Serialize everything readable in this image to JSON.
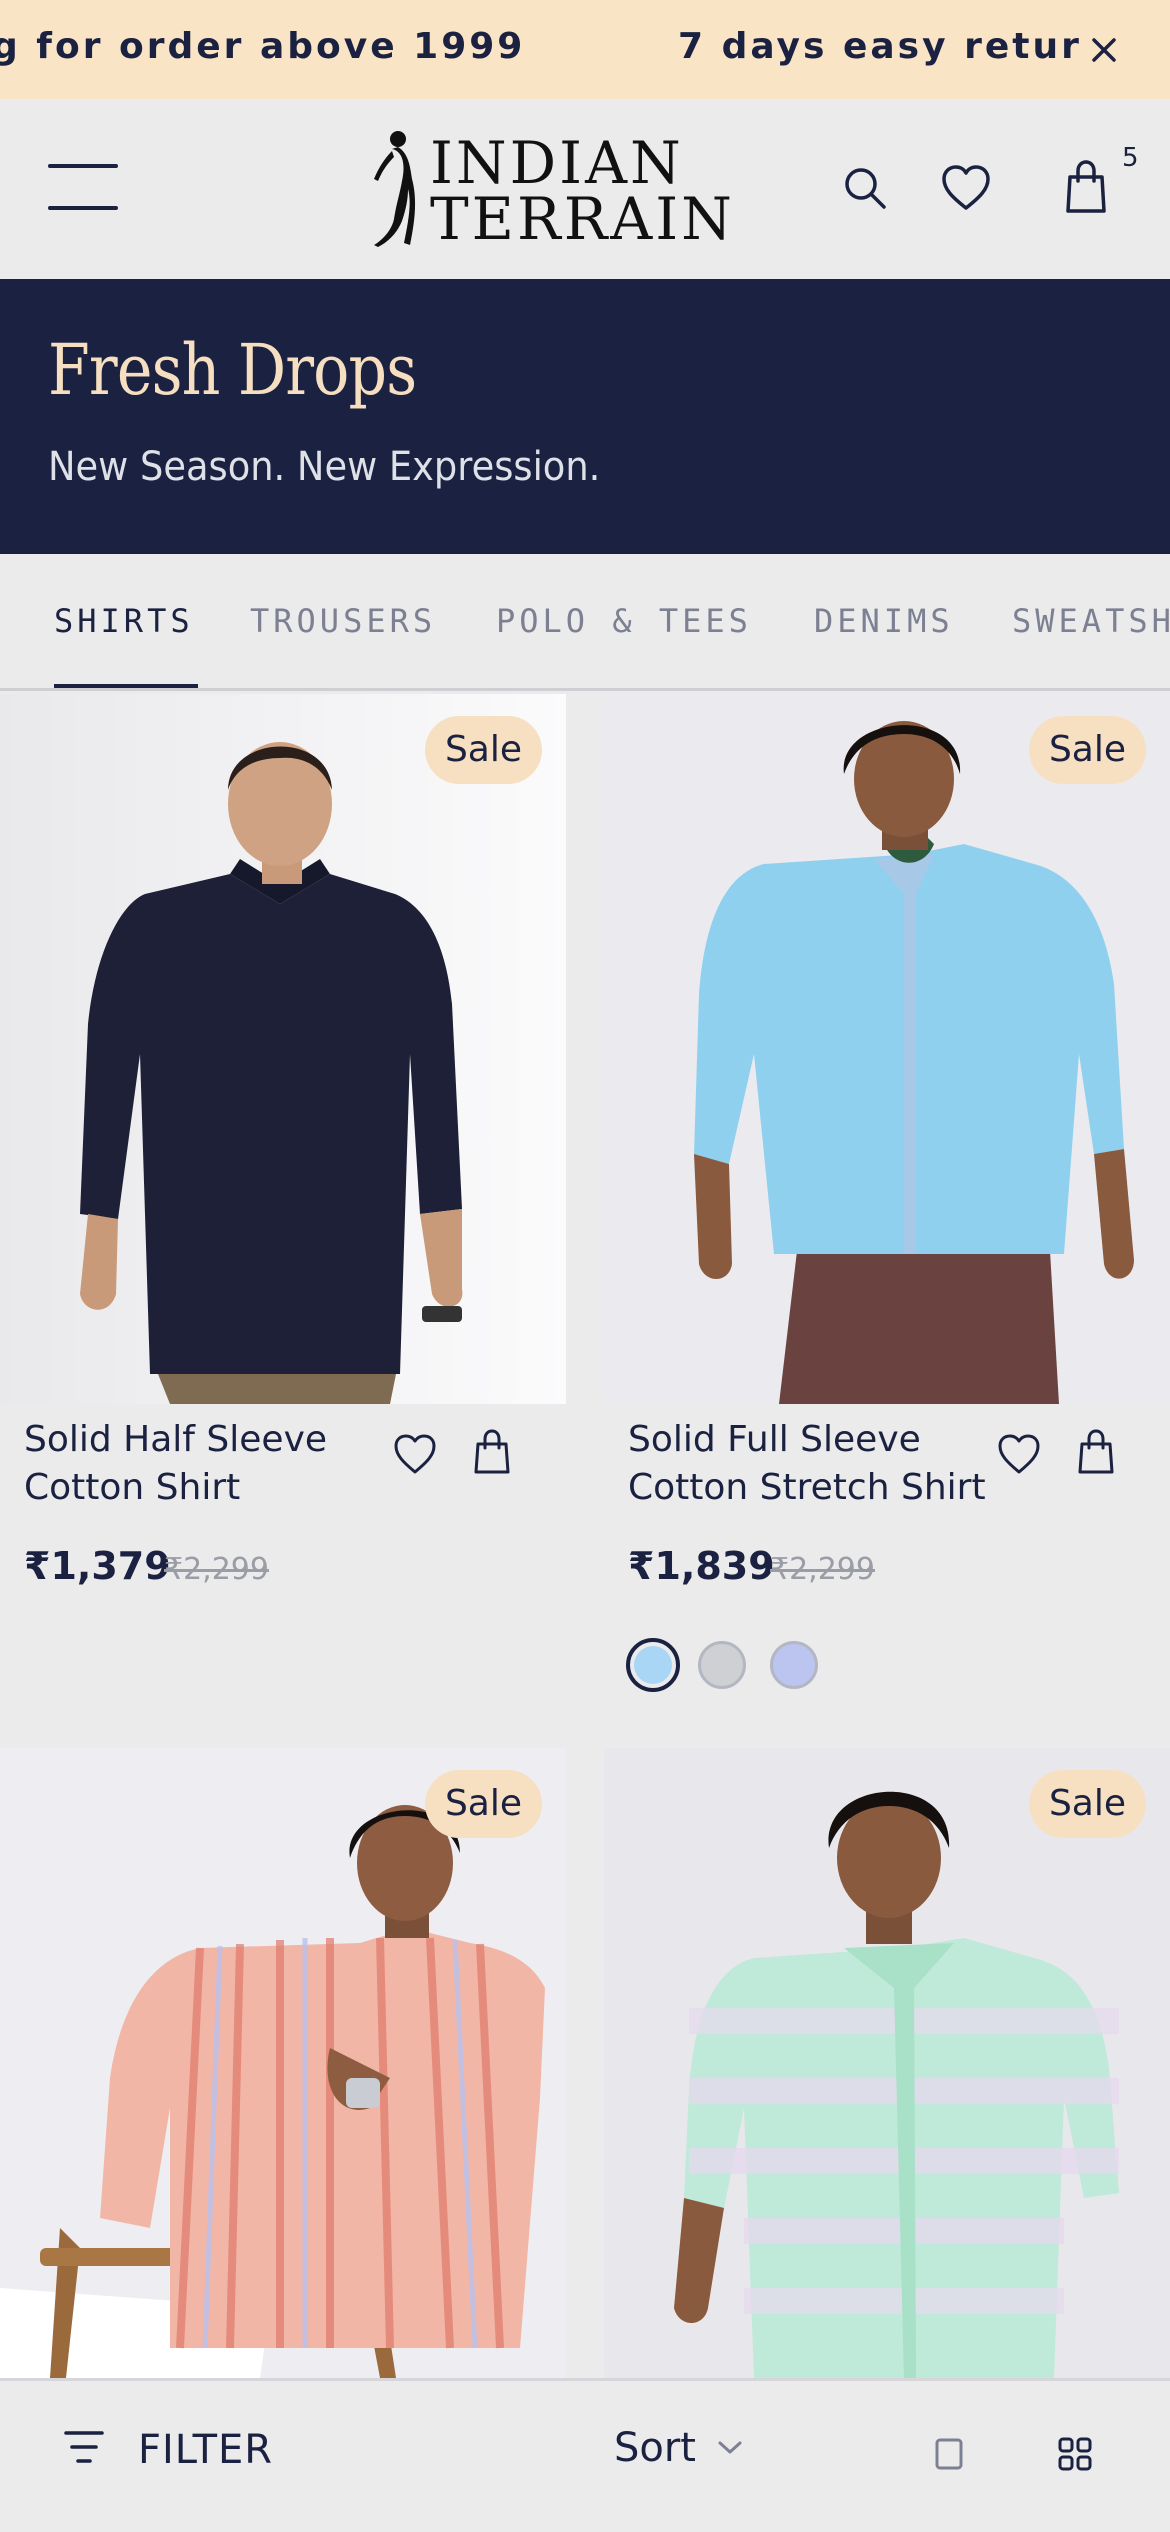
{
  "announcement": {
    "messages": [
      "g for order above 1999",
      "7 days easy retur"
    ],
    "close_icon": "close-icon"
  },
  "header": {
    "brand_line1": "INDIAN",
    "brand_line2": "TERRAIN",
    "bag_count": "5",
    "icons": [
      "menu-icon",
      "search-icon",
      "heart-icon",
      "bag-icon"
    ]
  },
  "hero": {
    "title": "Fresh Drops",
    "subtitle": "New Season. New Expression."
  },
  "tabs": [
    "SHIRTS",
    "TROUSERS",
    "POLO & TEES",
    "DENIMS",
    "SWEATSH"
  ],
  "active_tab": "SHIRTS",
  "products": [
    {
      "badge": "Sale",
      "name": "Solid Half Sleeve Cotton Shirt",
      "price": "₹1,379",
      "mrp": "₹2,299",
      "swatches": []
    },
    {
      "badge": "Sale",
      "name": "Solid Full Sleeve Cotton Stretch Shirt",
      "price": "₹1,839",
      "mrp": "₹2,299",
      "swatches": [
        "#a9d6f5",
        "#cfd0d4",
        "#bcc4f0"
      ]
    },
    {
      "badge": "Sale"
    },
    {
      "badge": "Sale"
    }
  ],
  "bottom_bar": {
    "filter_label": "FILTER",
    "sort_label": "Sort"
  },
  "colors": {
    "navy": "#1b2140",
    "cream": "#f9e4c6",
    "badge": "#f7e0c2",
    "page_bg": "#ebebeb"
  }
}
